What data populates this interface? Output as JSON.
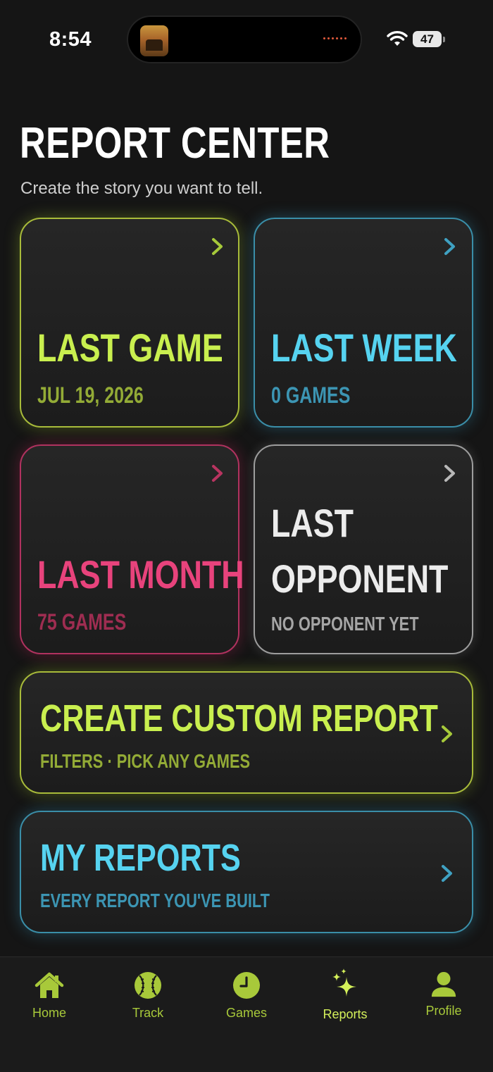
{
  "status_bar": {
    "time": "8:54",
    "battery": "47"
  },
  "header": {
    "title": "REPORT CENTER",
    "subtitle": "Create the story you want to tell."
  },
  "cards": {
    "last_game": {
      "title": "LAST GAME",
      "subtitle": "JUL 19, 2026"
    },
    "last_week": {
      "title": "LAST WEEK",
      "subtitle": "0 GAMES"
    },
    "last_month": {
      "title": "LAST MONTH",
      "subtitle": "75 GAMES"
    },
    "last_opponent": {
      "title_line1": "LAST",
      "title_line2": "OPPONENT",
      "subtitle": "NO OPPONENT YET"
    },
    "custom_report": {
      "title": "CREATE CUSTOM REPORT",
      "subtitle": "FILTERS · PICK ANY GAMES"
    },
    "my_reports": {
      "title": "MY REPORTS",
      "subtitle": "EVERY REPORT YOU'VE BUILT"
    }
  },
  "tabs": [
    {
      "label": "Home",
      "icon": "home-icon"
    },
    {
      "label": "Track",
      "icon": "baseball-icon"
    },
    {
      "label": "Games",
      "icon": "clock-icon"
    },
    {
      "label": "Reports",
      "icon": "sparkles-icon",
      "active": true
    },
    {
      "label": "Profile",
      "icon": "person-icon"
    }
  ],
  "colors": {
    "green": "#c9ef4f",
    "blue": "#56d3f0",
    "pink": "#e8437c",
    "white": "#ececec",
    "tab_accent": "#a8c93a"
  }
}
